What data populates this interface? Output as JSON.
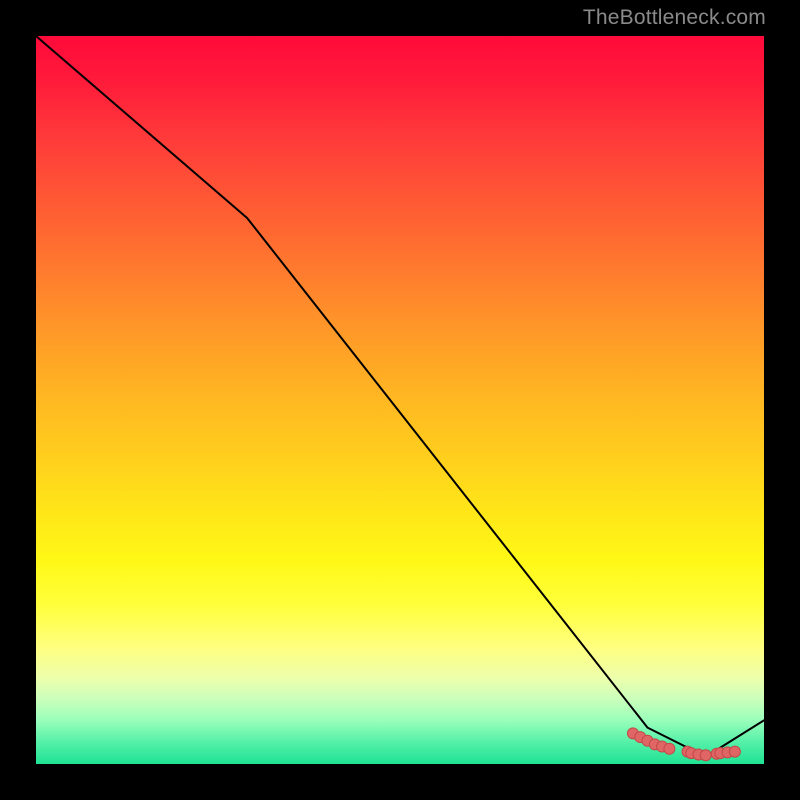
{
  "watermark": "TheBottleneck.com",
  "colors": {
    "line": "#000000",
    "marker_fill": "#e06666",
    "marker_stroke": "#c44848"
  },
  "chart_data": {
    "type": "line",
    "title": "",
    "xlabel": "",
    "ylabel": "",
    "xlim": [
      0,
      100
    ],
    "ylim": [
      0,
      100
    ],
    "grid": false,
    "legend": false,
    "series": [
      {
        "name": "curve",
        "x": [
          0,
          29,
          84,
          92,
          100
        ],
        "y": [
          100,
          75,
          5,
          1,
          6
        ],
        "style": "line"
      },
      {
        "name": "markers",
        "x": [
          82,
          83,
          84,
          85,
          86,
          87,
          89.5,
          90,
          91,
          92,
          93.5,
          94,
          95,
          96
        ],
        "y": [
          4.2,
          3.7,
          3.2,
          2.7,
          2.4,
          2.1,
          1.7,
          1.5,
          1.3,
          1.2,
          1.4,
          1.5,
          1.6,
          1.7
        ],
        "style": "scatter"
      }
    ]
  }
}
